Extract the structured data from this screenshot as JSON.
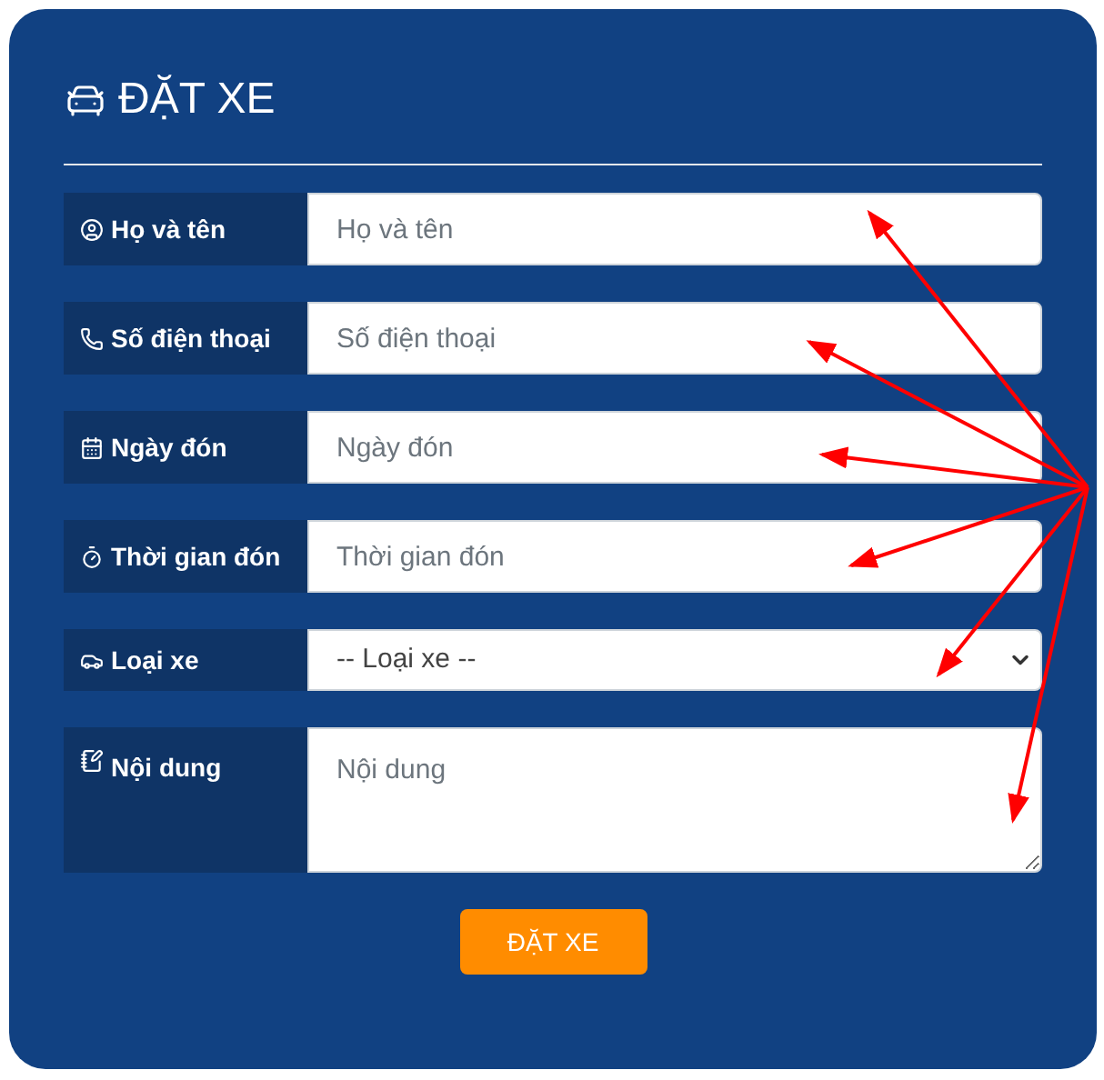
{
  "form": {
    "title": "ĐẶT XE",
    "fields": [
      {
        "kind": "input",
        "label": "Họ và tên",
        "placeholder": "Họ và tên"
      },
      {
        "kind": "input",
        "label": "Số điện thoại",
        "placeholder": "Số điện thoại"
      },
      {
        "kind": "input",
        "label": "Ngày đón",
        "placeholder": "Ngày đón"
      },
      {
        "kind": "input",
        "label": "Thời gian đón",
        "placeholder": "Thời gian đón"
      },
      {
        "kind": "select",
        "label": "Loại xe",
        "value": "-- Loại xe --"
      },
      {
        "kind": "textarea",
        "label": "Nội dung",
        "placeholder": "Nội dung"
      }
    ],
    "submit": "ĐẶT XE"
  }
}
